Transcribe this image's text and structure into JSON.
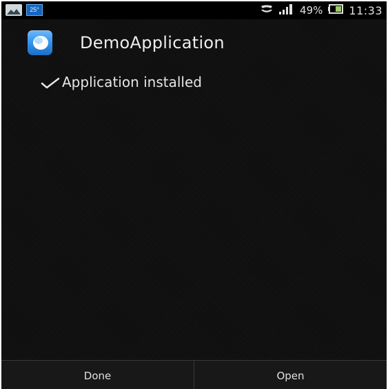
{
  "status_bar": {
    "weather_temp": "25°",
    "battery_percent": "49%",
    "time": "11:33",
    "icons": [
      "gallery-icon",
      "weather-icon",
      "sync-icon",
      "signal-icon",
      "battery-icon"
    ]
  },
  "app": {
    "name": "DemoApplication",
    "icon": "app-icon",
    "accent": "#2f8fe8"
  },
  "install": {
    "status_text": "Application installed",
    "icon": "check-icon"
  },
  "buttons": {
    "done_label": "Done",
    "open_label": "Open"
  }
}
